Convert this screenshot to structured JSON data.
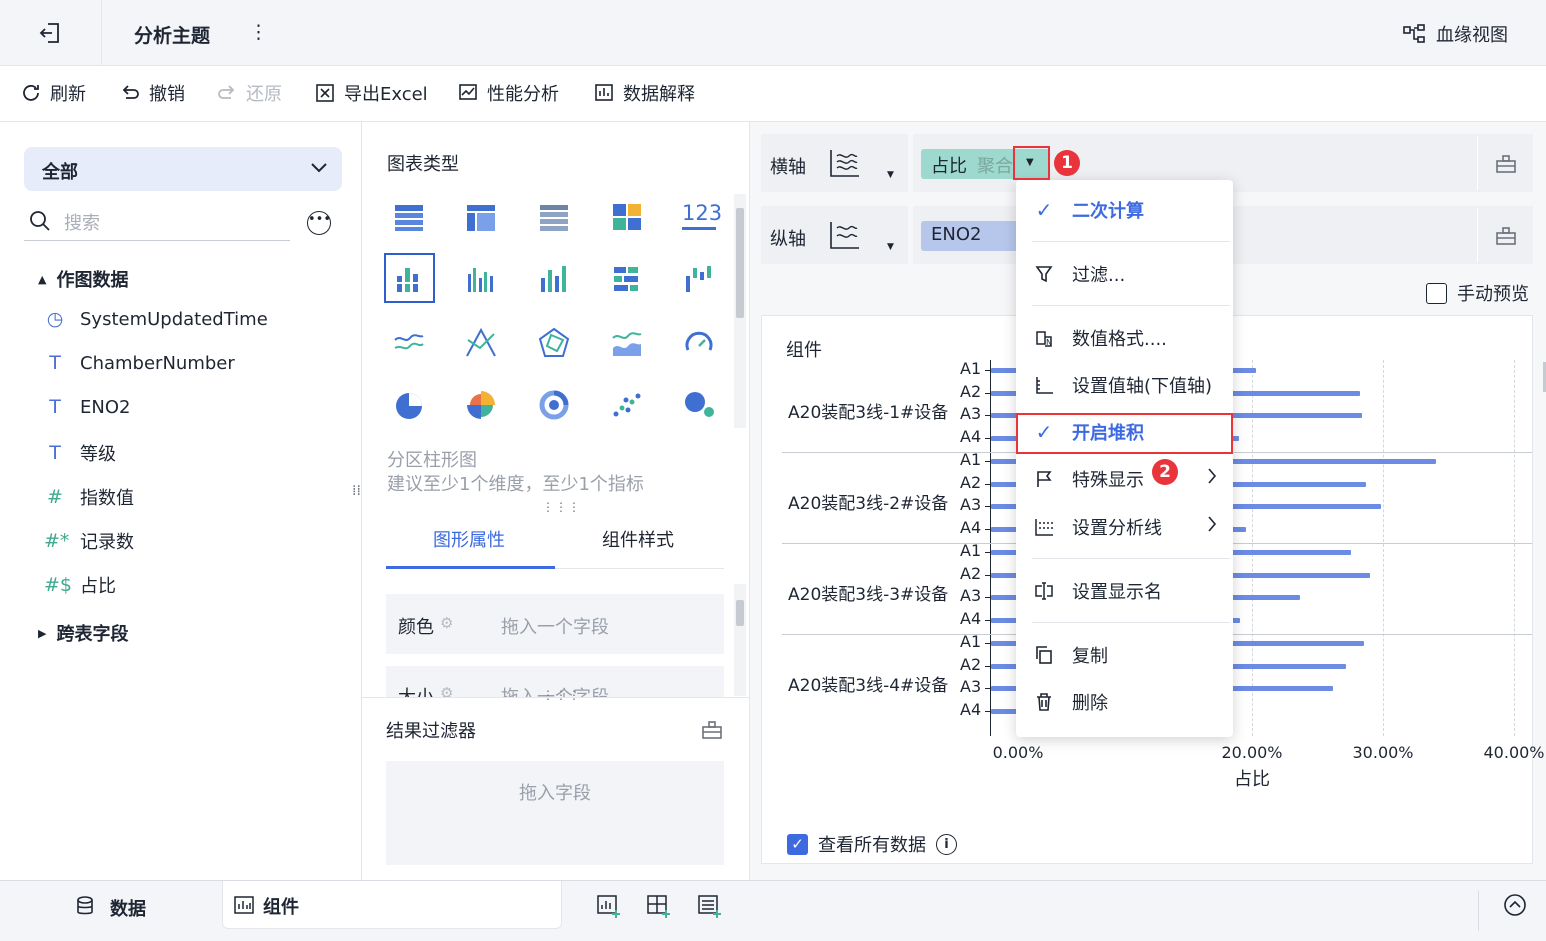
{
  "topbar": {
    "title": "分析主题",
    "more": "⋮",
    "lineage": "血缘视图"
  },
  "toolbar": {
    "refresh": "刷新",
    "undo": "撤销",
    "redo": "还原",
    "export": "导出Excel",
    "perf": "性能分析",
    "explain": "数据解释"
  },
  "left": {
    "scope": "全部",
    "search_placeholder": "搜索",
    "group1": "作图数据",
    "group2": "跨表字段",
    "fields": [
      {
        "icon": "clock-icon",
        "label": "SystemUpdatedTime"
      },
      {
        "icon": "text-field-icon",
        "label": "ChamberNumber"
      },
      {
        "icon": "text-field-icon",
        "label": "ENO2"
      },
      {
        "icon": "text-field-icon",
        "label": "等级"
      },
      {
        "icon": "number-field-icon",
        "label": "指数值"
      },
      {
        "icon": "record-count-icon",
        "label": "记录数"
      },
      {
        "icon": "computed-field-icon",
        "label": "占比"
      }
    ]
  },
  "mid": {
    "chart_type_title": "图表类型",
    "chart_name": "分区柱形图",
    "chart_hint": "建议至少1个维度，至少1个指标",
    "tab_active": "图形属性",
    "tab_other": "组件样式",
    "color_label": "颜色",
    "color_drop": "拖入一个字段",
    "size_label": "大小",
    "size_drop": "拖入一个字段",
    "filter_title": "结果过滤器",
    "filter_drop": "拖入字段"
  },
  "axes": {
    "x_label": "横轴",
    "x_pill": "占比",
    "x_pill_suffix": "聚合",
    "y_label": "纵轴",
    "y_pill": "ENO2",
    "manual_preview": "手动预览"
  },
  "chart": {
    "component_title": "组件",
    "xlabel": "占比",
    "show_all": "查看所有数据"
  },
  "chart_data": {
    "type": "bar",
    "orientation": "horizontal",
    "xlabel": "占比",
    "x_ticks": [
      "0.00%",
      "20.00%",
      "30.00%",
      "40.00%"
    ],
    "groups": [
      {
        "name": "A20装配3线-1#设备",
        "categories": [
          "A1",
          "A2",
          "A3",
          "A4"
        ],
        "values": [
          20.2,
          28.2,
          28.3,
          18.9
        ]
      },
      {
        "name": "A20装配3线-2#设备",
        "categories": [
          "A1",
          "A2",
          "A3",
          "A4"
        ],
        "values": [
          34.0,
          28.6,
          29.8,
          19.5
        ]
      },
      {
        "name": "A20装配3线-3#设备",
        "categories": [
          "A1",
          "A2",
          "A3",
          "A4"
        ],
        "values": [
          27.5,
          28.9,
          23.6,
          19.0
        ]
      },
      {
        "name": "A20装配3线-4#设备",
        "categories": [
          "A1",
          "A2",
          "A3",
          "A4"
        ],
        "values": [
          28.5,
          27.1,
          26.1,
          18.2
        ]
      }
    ]
  },
  "menu": {
    "items": [
      "二次计算",
      "过滤...",
      "数值格式....",
      "设置值轴(下值轴)",
      "开启堆积",
      "特殊显示",
      "设置分析线",
      "设置显示名",
      "复制",
      "删除"
    ]
  },
  "badges": {
    "b1": "1",
    "b2": "2"
  },
  "bottom": {
    "data_tab": "数据",
    "component_tab": "组件"
  },
  "colors": {
    "accent": "#3d6ae0",
    "highlight": "#e8343a",
    "bar": "#6b8be5",
    "pill_x": "#9ed9cf",
    "pill_y": "#b7c7ec"
  }
}
